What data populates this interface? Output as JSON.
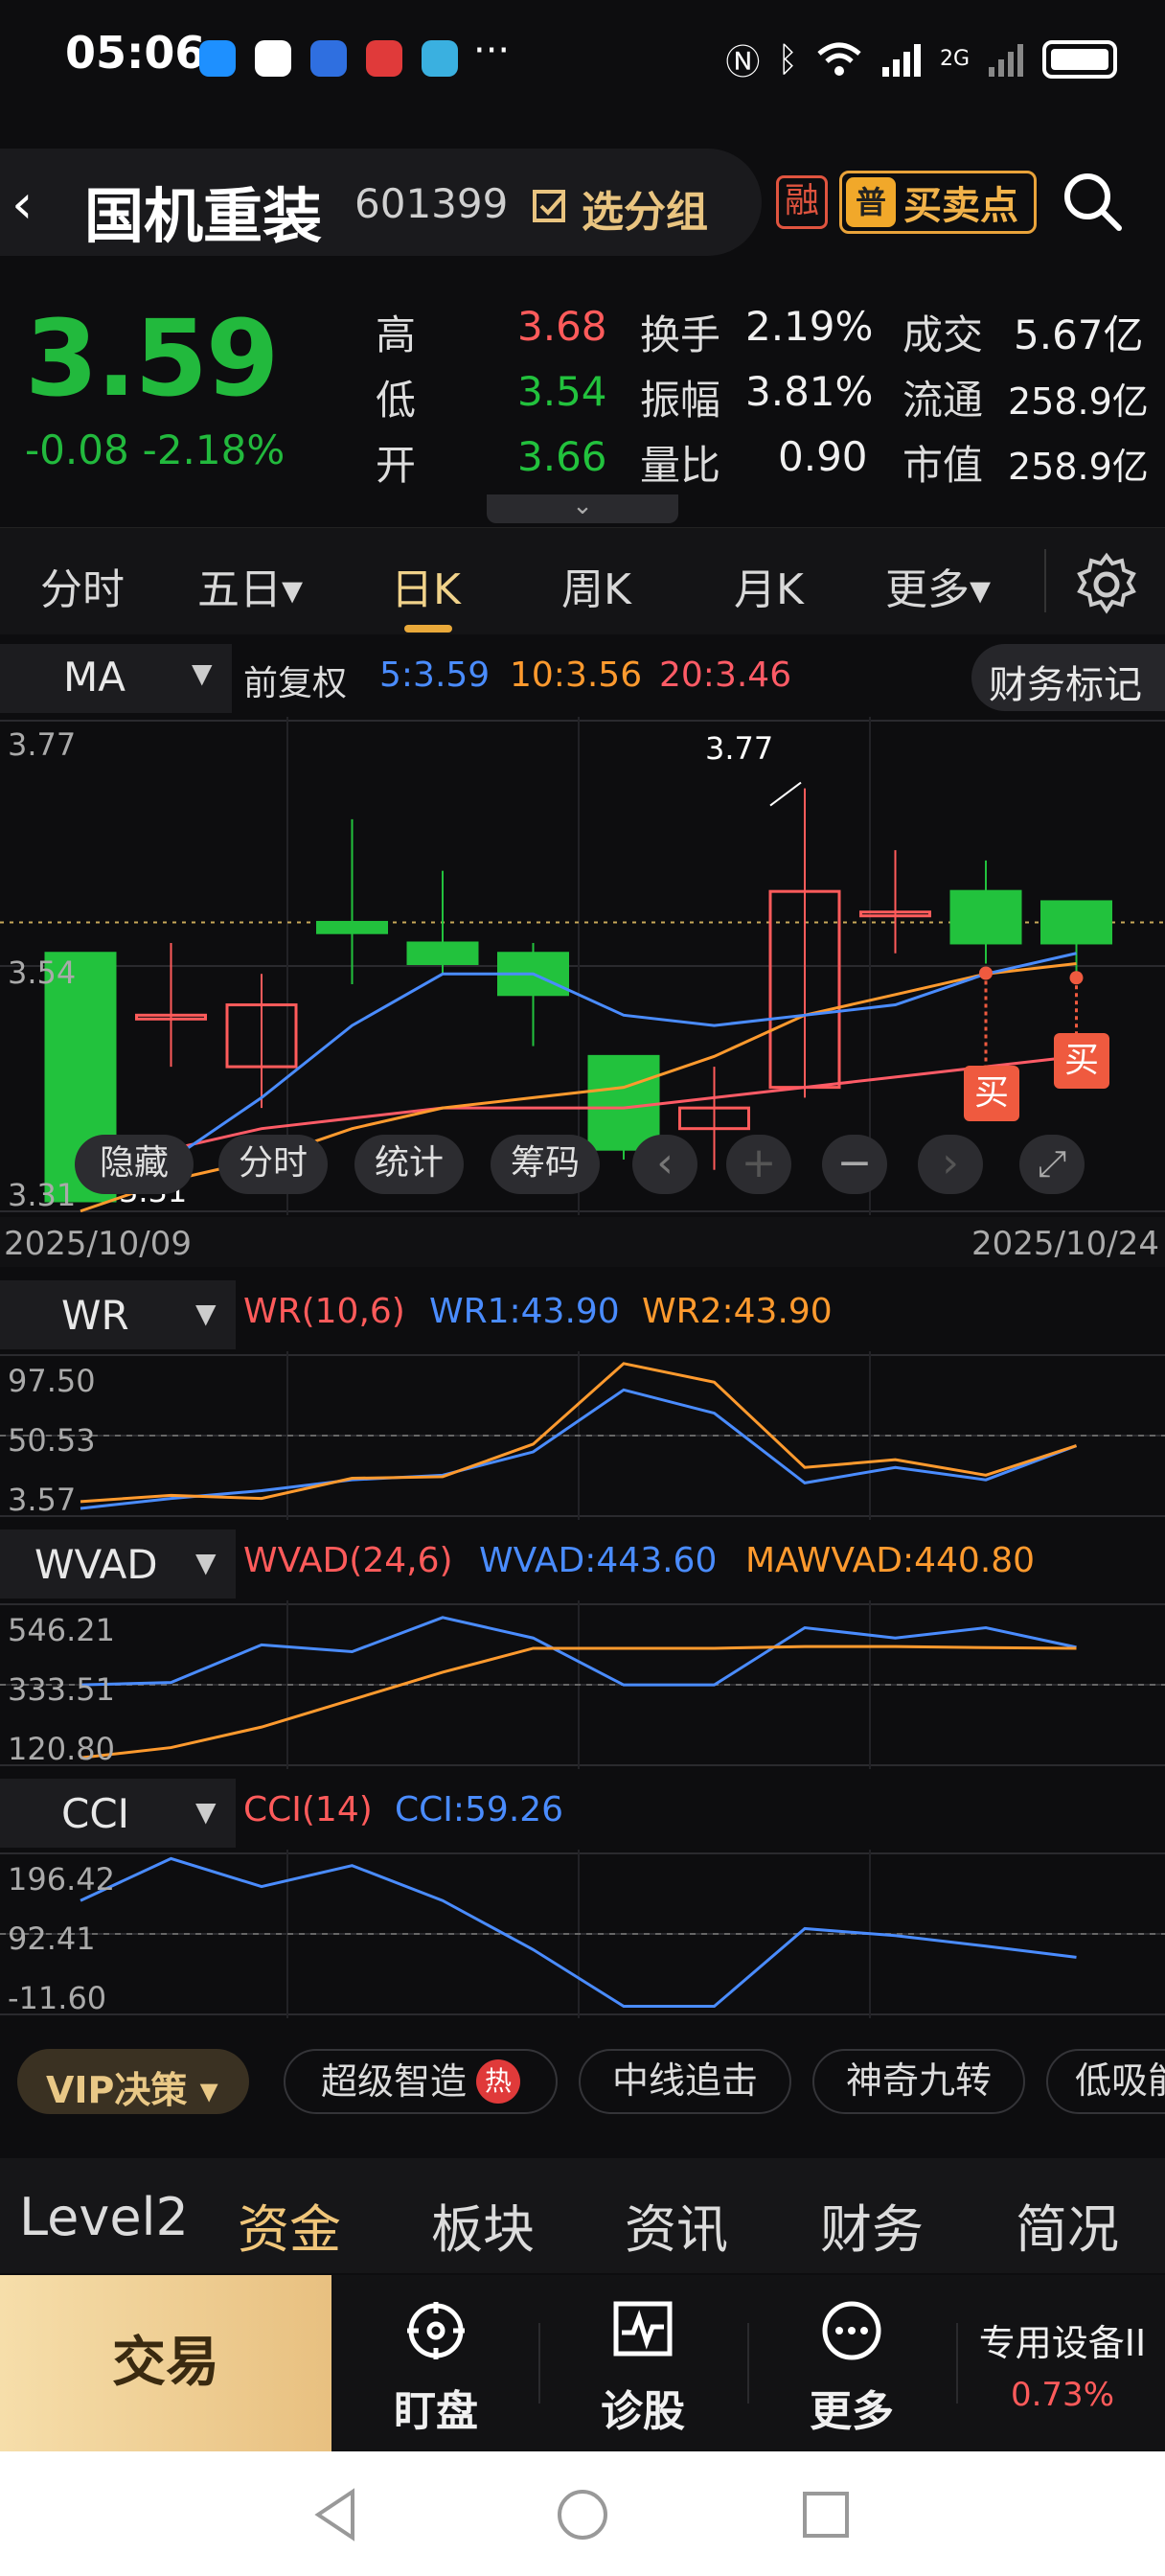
{
  "status": {
    "time": "05:06",
    "more": "···",
    "net": "2G"
  },
  "header": {
    "back": "‹",
    "name": "国机重装",
    "code": "601399",
    "group_label": "选分组",
    "rong": "融",
    "buysell_badge": "普",
    "buysell_label": "买卖点"
  },
  "quote": {
    "price": "3.59",
    "change": "-0.08",
    "change_pct": "-2.18%",
    "high_label": "高",
    "high": "3.68",
    "low_label": "低",
    "low": "3.54",
    "open_label": "开",
    "open": "3.66",
    "turnover_label": "换手",
    "turnover": "2.19%",
    "amplitude_label": "振幅",
    "amplitude": "3.81%",
    "vol_ratio_label": "量比",
    "vol_ratio": "0.90",
    "amount_label": "成交",
    "amount": "5.67亿",
    "float_label": "流通",
    "float": "258.9亿",
    "mcap_label": "市值",
    "mcap": "258.9亿",
    "expand": "⌄"
  },
  "tabs": [
    {
      "label": "分时"
    },
    {
      "label": "五日▾"
    },
    {
      "label": "日K",
      "active": true
    },
    {
      "label": "周K"
    },
    {
      "label": "月K"
    },
    {
      "label": "更多▾"
    }
  ],
  "ma": {
    "select": "MA",
    "arrow": "▼",
    "fq": "前复权",
    "ma5": "5:3.59",
    "ma10": "10:3.56",
    "ma20": "20:3.46",
    "finance": "财务标记"
  },
  "kchart": {
    "y_top": "3.77",
    "y_mid": "3.54",
    "y_bot": "3.31",
    "hi_label": "3.77",
    "lo_label": "3.31",
    "date_start": "2025/10/09",
    "date_end": "2025/10/24",
    "buy1": "买",
    "buy2": "买",
    "candles": [
      {
        "o": 3.55,
        "c": 3.31,
        "h": 3.55,
        "l": 3.31
      },
      {
        "o": 3.49,
        "c": 3.49,
        "h": 3.56,
        "l": 3.44
      },
      {
        "o": 3.44,
        "c": 3.5,
        "h": 3.53,
        "l": 3.4
      },
      {
        "o": 3.58,
        "c": 3.57,
        "h": 3.68,
        "l": 3.52
      },
      {
        "o": 3.56,
        "c": 3.54,
        "h": 3.63,
        "l": 3.53
      },
      {
        "o": 3.55,
        "c": 3.51,
        "h": 3.56,
        "l": 3.46
      },
      {
        "o": 3.45,
        "c": 3.36,
        "h": 3.45,
        "l": 3.35
      },
      {
        "o": 3.38,
        "c": 3.4,
        "h": 3.44,
        "l": 3.34
      },
      {
        "o": 3.42,
        "c": 3.61,
        "h": 3.71,
        "l": 3.41
      },
      {
        "o": 3.59,
        "c": 3.59,
        "h": 3.65,
        "l": 3.55
      },
      {
        "o": 3.61,
        "c": 3.56,
        "h": 3.64,
        "l": 3.54
      },
      {
        "o": 3.6,
        "c": 3.56,
        "h": 3.6,
        "l": 3.53
      }
    ],
    "ma5": [
      3.33,
      3.35,
      3.41,
      3.48,
      3.53,
      3.53,
      3.49,
      3.48,
      3.49,
      3.5,
      3.53,
      3.55
    ],
    "ma10": [
      3.3,
      3.33,
      3.35,
      3.38,
      3.4,
      3.41,
      3.42,
      3.45,
      3.49,
      3.51,
      3.53,
      3.54
    ],
    "ma20": [
      3.35,
      3.36,
      3.38,
      3.39,
      3.4,
      3.4,
      3.4,
      3.41,
      3.42,
      3.43,
      3.44,
      3.45
    ]
  },
  "tools": [
    "隐藏",
    "分时",
    "统计",
    "筹码",
    "‹",
    "+",
    "−",
    "›",
    "⤢"
  ],
  "wr": {
    "select": "WR",
    "arrow": "▼",
    "param": "WR(10,6)",
    "wr1": "WR1:43.90",
    "wr2": "WR2:43.90",
    "y_top": "97.50",
    "y_mid": "50.53",
    "y_bot": "3.57",
    "s1": [
      3.6,
      10,
      15,
      22,
      25,
      40,
      80,
      65,
      20,
      30,
      22,
      44
    ],
    "s2": [
      8,
      12,
      10,
      23,
      24,
      45,
      97,
      85,
      30,
      35,
      25,
      44
    ]
  },
  "wvad": {
    "select": "WVAD",
    "arrow": "▼",
    "param": "WVAD(24,6)",
    "v1": "WVAD:443.60",
    "v2": "MAWVAD:440.80",
    "y_top": "546.21",
    "y_mid": "333.51",
    "y_bot": "120.80",
    "s1": [
      333,
      340,
      450,
      430,
      530,
      470,
      333,
      333,
      500,
      470,
      500,
      443
    ],
    "s2": [
      120,
      150,
      210,
      290,
      370,
      440,
      440,
      440,
      445,
      445,
      442,
      440
    ]
  },
  "cci": {
    "select": "CCI",
    "arrow": "▼",
    "param": "CCI(14)",
    "v1": "CCI:59.26",
    "y_top": "196.42",
    "y_mid": "92.41",
    "y_bot": "-11.60",
    "s1": [
      140,
      200,
      160,
      190,
      140,
      70,
      -11,
      -11,
      100,
      90,
      75,
      59
    ]
  },
  "strategy": {
    "vip": "VIP决策 ▾",
    "items": [
      "超级智造",
      "中线追击",
      "神奇九转",
      "低吸能"
    ],
    "hot": "热"
  },
  "subnav": [
    "Level2",
    "资金",
    "板块",
    "资讯",
    "财务",
    "简况"
  ],
  "dock": {
    "trade": "交易",
    "items": [
      "盯盘",
      "诊股",
      "更多"
    ],
    "sector": "专用设备II",
    "sector_pct": "0.73%"
  },
  "colors": {
    "up": "#ff5b5b",
    "down": "#22c23d",
    "ma5": "#4a8cff",
    "ma10": "#ff9a2e",
    "ma20": "#ff5b66",
    "accent": "#e9c480"
  }
}
